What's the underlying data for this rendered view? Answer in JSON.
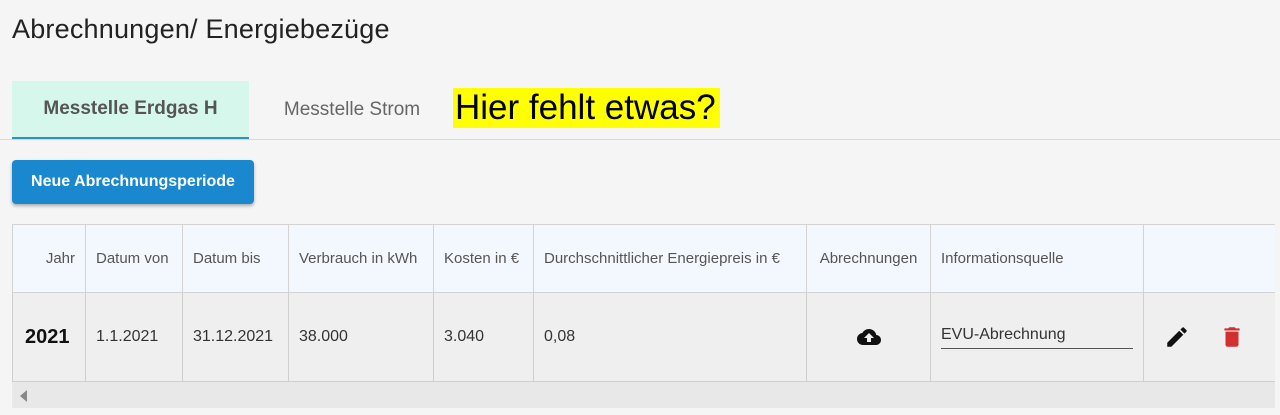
{
  "page": {
    "title": "Abrechnungen/ Energiebezüge"
  },
  "tabs": [
    {
      "label": "Messtelle Erdgas H",
      "active": true
    },
    {
      "label": "Messtelle Strom",
      "active": false
    }
  ],
  "annotation": {
    "text": "Hier fehlt etwas?",
    "background": "#ffff00"
  },
  "actions": {
    "new_period_label": "Neue Abrechnungsperiode"
  },
  "table": {
    "columns": [
      "Jahr",
      "Datum von",
      "Datum bis",
      "Verbrauch in kWh",
      "Kosten in €",
      "Durchschnittlicher Energiepreis in €",
      "Abrechnungen",
      "Informationsquelle",
      ""
    ],
    "rows": [
      {
        "year": "2021",
        "from": "1.1.2021",
        "to": "31.12.2021",
        "consumption": "38.000",
        "cost": "3.040",
        "avg_price": "0,08",
        "invoice_icon": "cloud-upload-icon",
        "source": "EVU-Abrechnung",
        "edit_icon": "pencil-icon",
        "delete_icon": "trash-icon"
      }
    ]
  },
  "colors": {
    "accent": "#1a88cf",
    "active_tab_bg": "#d6f7ec",
    "header_bg": "#f2f8fd",
    "delete": "#d32f2f"
  }
}
